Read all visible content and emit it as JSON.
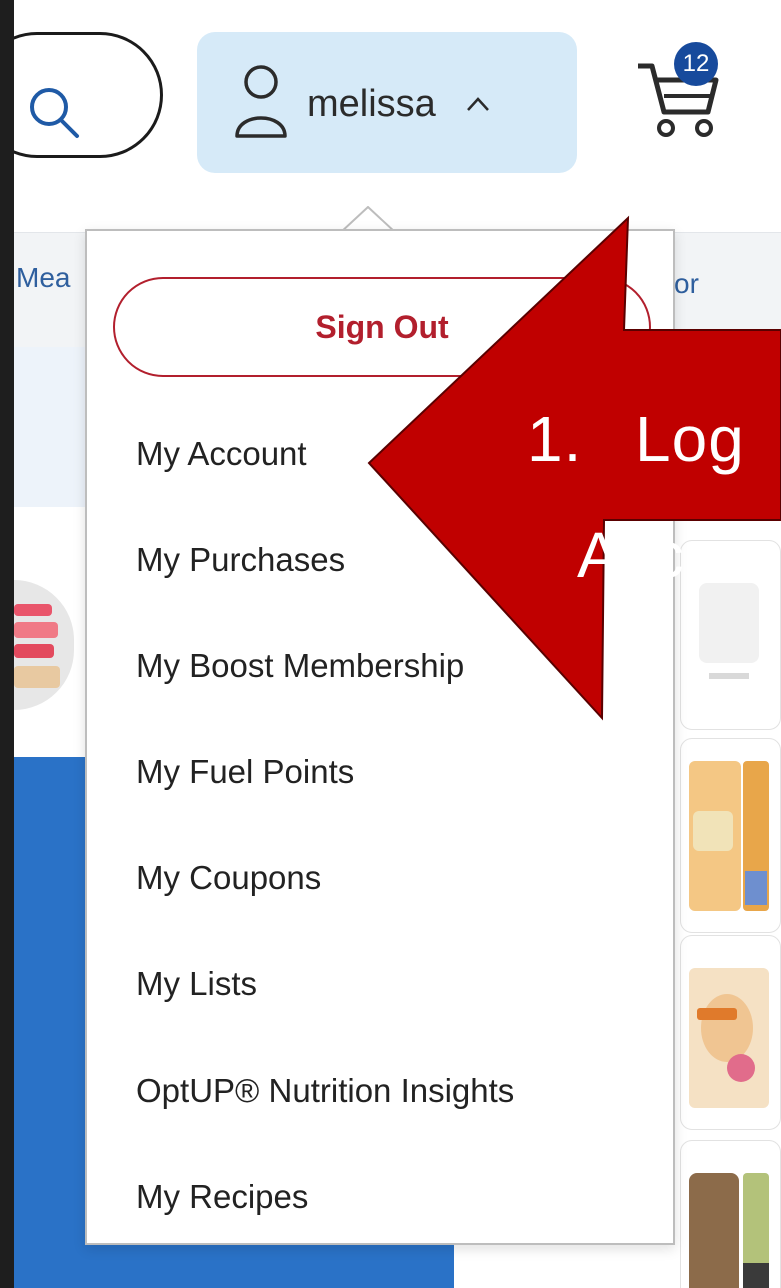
{
  "header": {
    "account_name": "melissa",
    "cart_count": "12"
  },
  "nav": {
    "left_label": "Mea",
    "right_label": "or"
  },
  "account_menu": {
    "sign_out_label": "Sign Out",
    "items": [
      "My Account",
      "My Purchases",
      "My Boost Membership",
      "My Fuel Points",
      "My Coupons",
      "My Lists",
      "OptUP® Nutrition Insights",
      "My Recipes"
    ]
  },
  "annotation": {
    "number": "1.",
    "line1": "Log",
    "line2": "Acco",
    "arrow_color": "#c00000"
  },
  "colors": {
    "accent": "#174a9c",
    "sign_out": "#b21f2d",
    "account_button_bg": "#d6eaf8"
  }
}
